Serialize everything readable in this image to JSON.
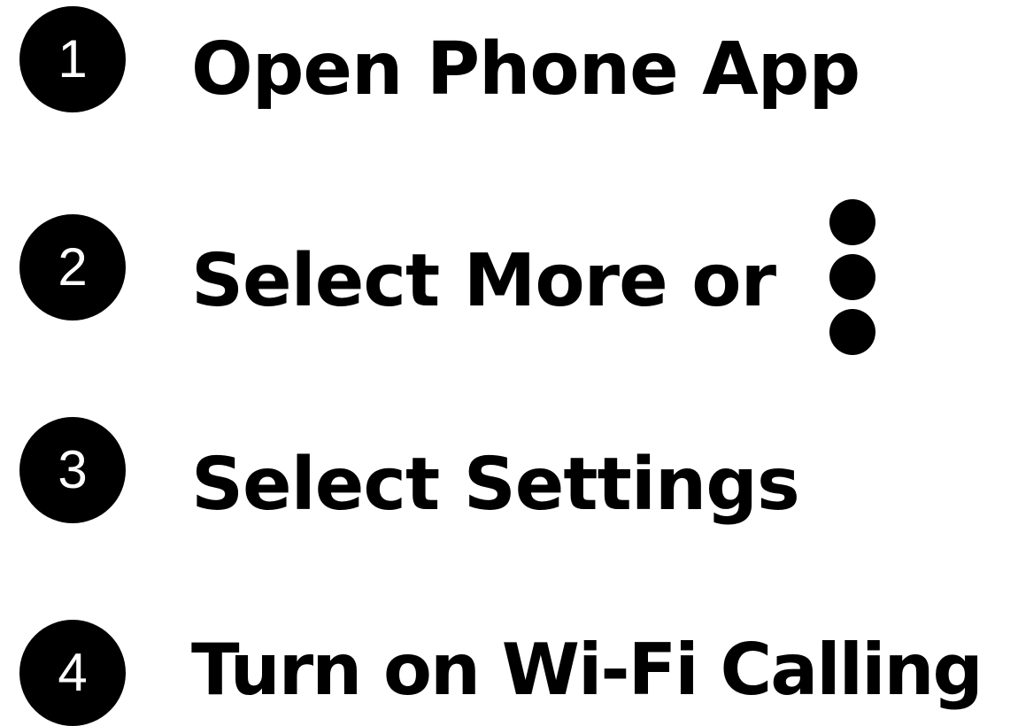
{
  "steps": [
    {
      "number": "1",
      "label": "Open Phone App"
    },
    {
      "number": "2",
      "label": "Select More or",
      "icon": "vertical-ellipsis-more-icon"
    },
    {
      "number": "3",
      "label": "Select Settings"
    },
    {
      "number": "4",
      "label": "Turn on Wi-Fi Calling"
    }
  ],
  "colors": {
    "text": "#000000",
    "badge_fill": "#000000",
    "badge_text": "#ffffff",
    "background": "#ffffff"
  }
}
